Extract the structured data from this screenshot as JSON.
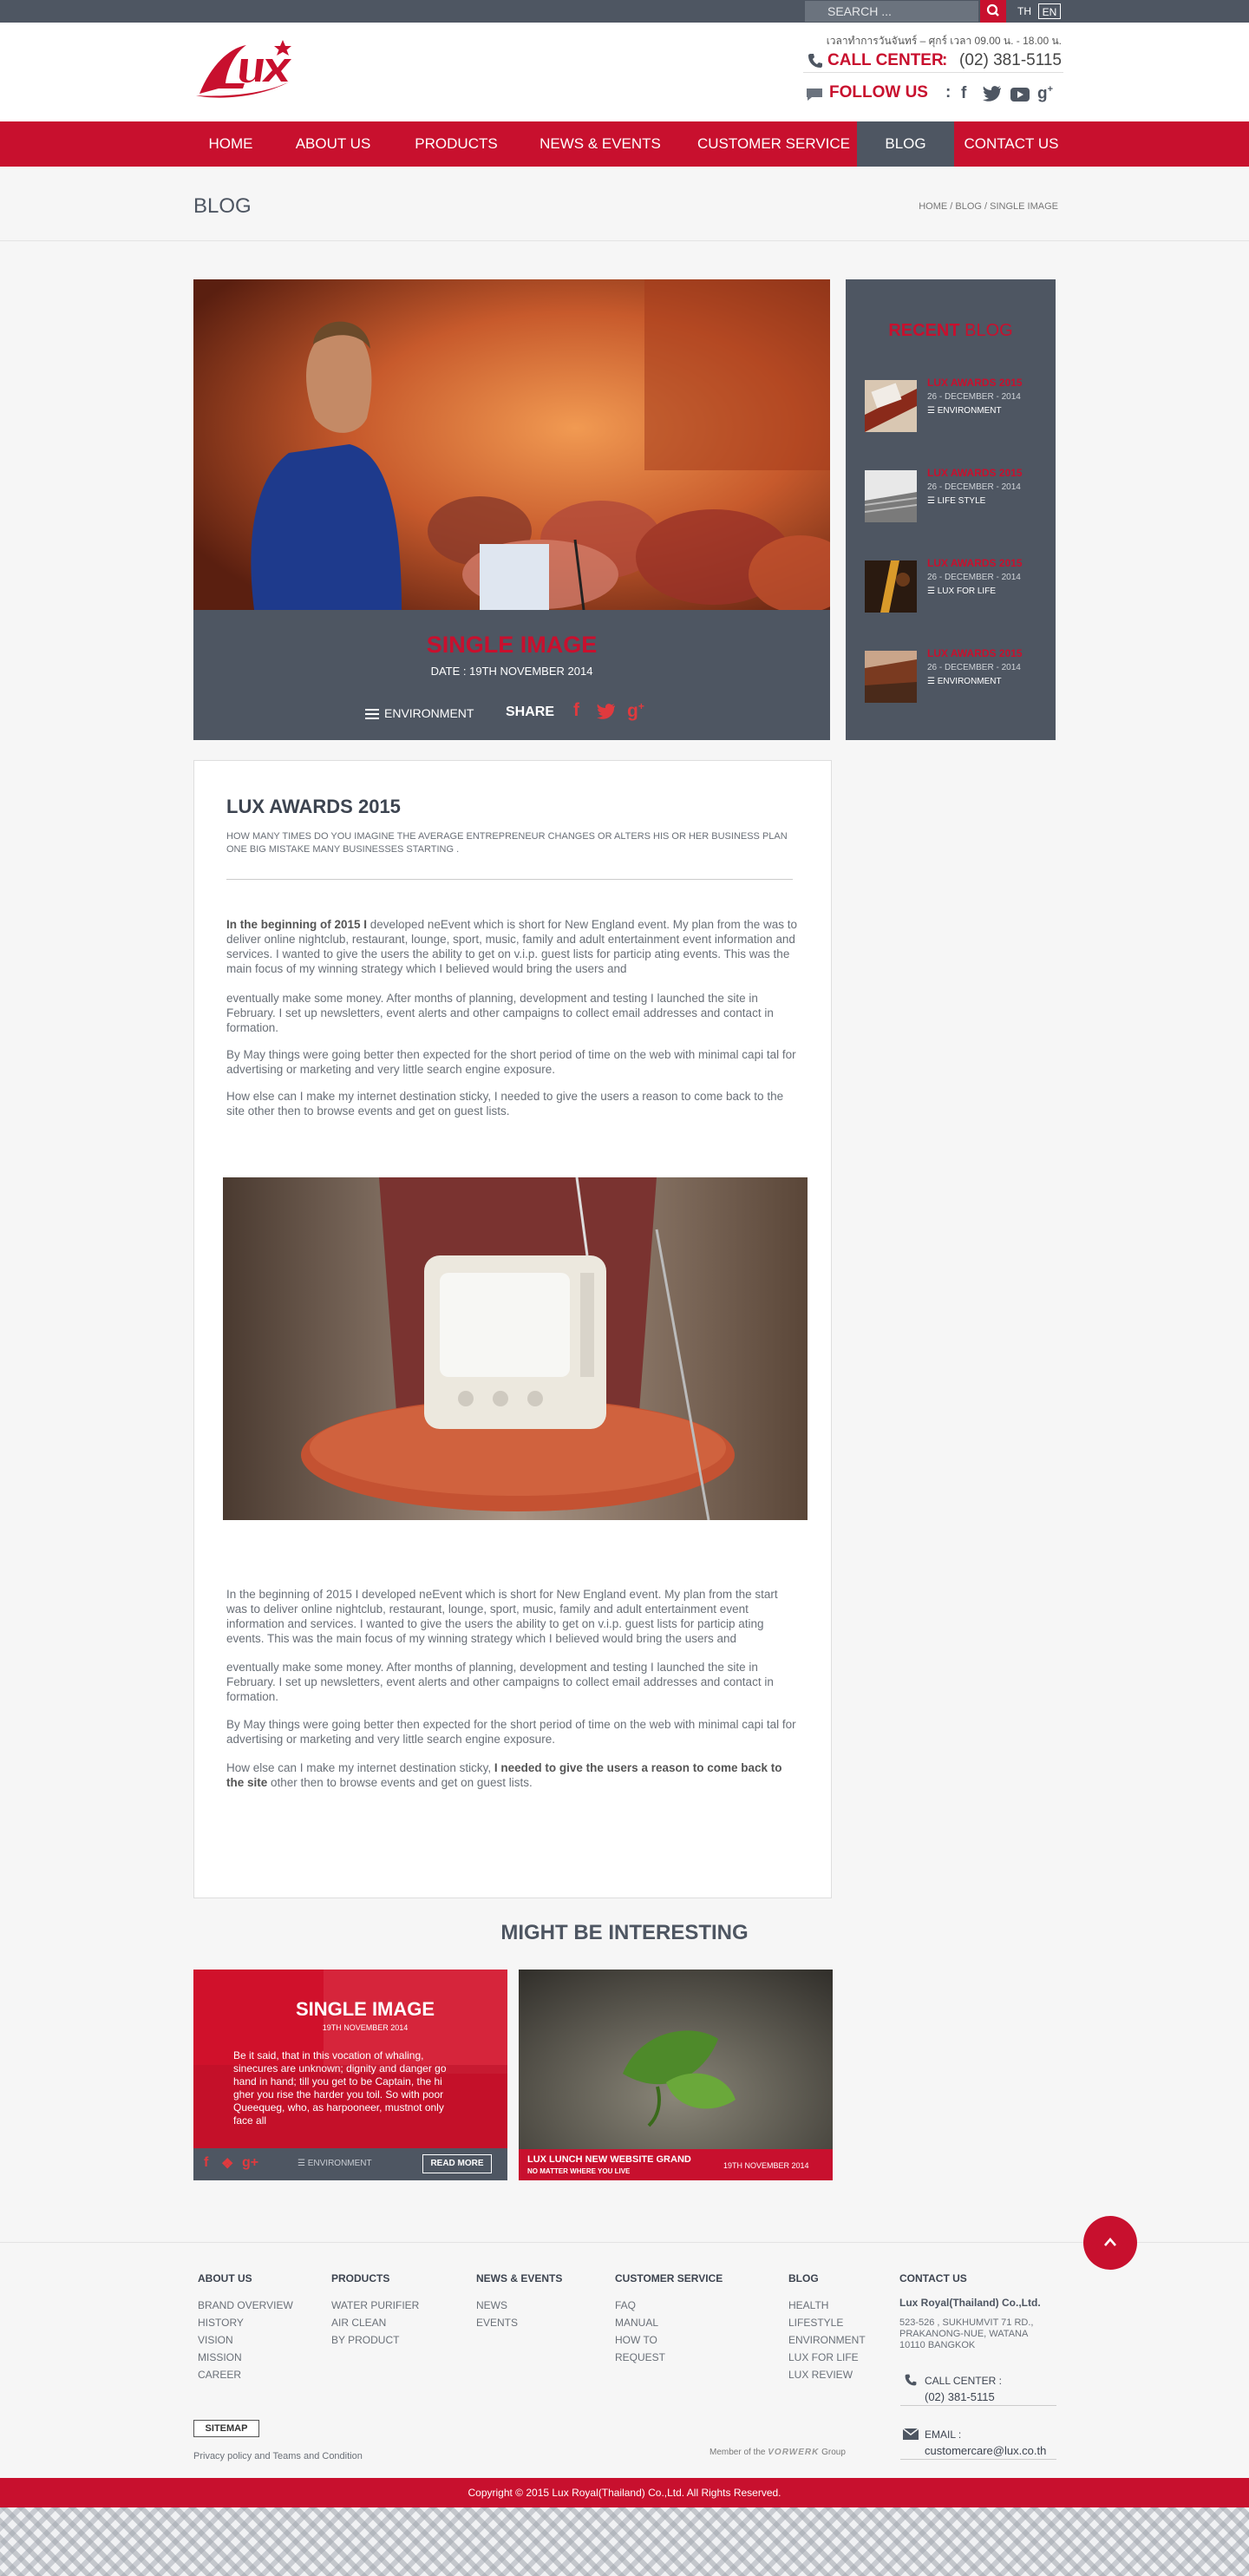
{
  "topbar": {
    "search_placeholder": "SEARCH ...",
    "lang_th": "TH",
    "lang_en": "EN"
  },
  "header": {
    "logo_text": "LUX",
    "hours": "เวลาทำการวันจันทร์ – ศุกร์ เวลา 09.00 น. - 18.00 น.",
    "call_label": "CALL CENTER",
    "call_sep": ":",
    "call_number": "(02) 381-5115",
    "follow_label": "FOLLOW US",
    "follow_sep": ":",
    "social_icons": [
      "facebook-icon",
      "twitter-icon",
      "youtube-icon",
      "google-plus-icon"
    ]
  },
  "nav": {
    "items": [
      "HOME",
      "ABOUT US",
      "PRODUCTS",
      "NEWS & EVENTS",
      "CUSTOMER SERVICE",
      "BLOG",
      "CONTACT US"
    ],
    "active": "BLOG"
  },
  "page": {
    "title": "BLOG",
    "breadcrumb": "HOME /  BLOG / SINGLE IMAGE"
  },
  "hero": {
    "title": "SINGLE IMAGE",
    "date": "DATE : 19TH NOVEMBER 2014",
    "category": "ENVIRONMENT",
    "share_label": "SHARE"
  },
  "sidebar": {
    "title_a": "RECENT",
    "title_b": "BLOG",
    "items": [
      {
        "title": "LUX AWARDS 2015",
        "date": "26 - DECEMBER - 2014",
        "category": "ENVIRONMENT"
      },
      {
        "title": "LUX AWARDS 2015",
        "date": "26 - DECEMBER - 2014",
        "category": "LIFE STYLE"
      },
      {
        "title": "LUX AWARDS 2015",
        "date": "26 - DECEMBER - 2014",
        "category": "LUX FOR LIFE"
      },
      {
        "title": "LUX AWARDS 2015",
        "date": "26 - DECEMBER - 2014",
        "category": "ENVIRONMENT"
      }
    ]
  },
  "article": {
    "title": "LUX AWARDS 2015",
    "lede": "HOW MANY TIMES DO YOU IMAGINE THE AVERAGE ENTREPRENEUR CHANGES OR ALTERS HIS OR HER BUSINESS PLAN ONE BIG MISTAKE MANY BUSINESSES STARTING .",
    "p1_bold": "In the beginning of 2015 I",
    "p1_rest": " developed neEvent which is short for New England event. My plan from the was to deliver online nightclub, restaurant, lounge, sport, music, family and adult entertainment event information and services. I wanted to give the users the ability to get on v.i.p. guest lists for particip ating events. This was the main focus of my winning strategy which I believed would bring the users and",
    "p2": "eventually make some money. After months of planning, development and testing I launched the site in February. I set up newsletters, event alerts and other campaigns to collect email addresses and contact in formation.",
    "p3": "By May things were going better then expected for the short period of time on the web with minimal capi tal for advertising or marketing and very little search engine exposure.",
    "p4": "How else can I make my internet destination sticky, I needed to give the users a reason to come back to the site other then to browse events and get on guest lists.",
    "p5": "In the beginning of 2015 I developed neEvent which is short for New England event. My plan from the start was to deliver online nightclub, restaurant, lounge, sport, music, family and adult entertainment event information and services. I wanted to give the users the ability to get on v.i.p. guest lists for particip ating events. This was the main focus of my winning strategy which I believed would bring the users and",
    "p6": "eventually make some money. After months of planning, development and testing I launched the site in February. I set up newsletters, event alerts and other campaigns to collect email addresses and contact in formation.",
    "p7": "By May things were going better then expected for the short period of time on the web with minimal capi tal for advertising or marketing and very little search engine exposure.",
    "p8_plain": "How else can I make my internet destination sticky, ",
    "p8_bold": "I needed to give the users a reason to come back to the site",
    "p8_rest": " other then to browse events and get on guest lists."
  },
  "related": {
    "heading": "MIGHT BE INTERESTING",
    "card1": {
      "title": "SINGLE IMAGE",
      "date": "19TH NOVEMBER 2014",
      "excerpt": "Be it said, that in this vocation of whaling, sinecures are unknown; dignity and danger go hand in hand; till you get to be Captain, the hi gher you rise the harder you toil. So with poor Queequeg, who, as harpooneer, mustnot only face all",
      "category": "ENVIRONMENT",
      "button": "READ MORE"
    },
    "card2": {
      "title": "LUX LUNCH NEW WEBSITE GRAND",
      "subtitle": "NO MATTER WHERE YOU LIVE",
      "date": "19TH NOVEMBER 2014"
    }
  },
  "footer": {
    "columns": [
      {
        "head": "ABOUT US",
        "links": [
          "BRAND OVERVIEW",
          "HISTORY",
          "VISION",
          "MISSION",
          "CAREER"
        ]
      },
      {
        "head": "PRODUCTS",
        "links": [
          "WATER PURIFIER",
          "AIR CLEAN",
          "BY PRODUCT"
        ]
      },
      {
        "head": "NEWS & EVENTS",
        "links": [
          "NEWS",
          "EVENTS"
        ]
      },
      {
        "head": "CUSTOMER  SERVICE",
        "links": [
          "FAQ",
          "MANUAL",
          "HOW TO",
          "REQUEST"
        ]
      },
      {
        "head": "BLOG",
        "links": [
          "HEALTH",
          "LIFESTYLE",
          "ENVIRONMENT",
          "LUX FOR LIFE",
          "LUX REVIEW"
        ]
      }
    ],
    "contact": {
      "head": "CONTACT US",
      "company": "Lux Royal(Thailand) Co.,Ltd.",
      "address": "523-526 , SUKHUMVIT 71 RD., PRAKANONG-NUE, WATANA 10110 BANGKOK",
      "call_label": "CALL CENTER :",
      "call_value": "(02) 381-5115",
      "email_label": "EMAIL :",
      "email_value": "customercare@lux.co.th"
    },
    "sitemap": "SITEMAP",
    "privacy": "Privacy policy and Teams and Condition",
    "member_pre": "Member of the",
    "member_brand": "VORWERK",
    "member_post": "Group",
    "copyright": "Copyright  © 2015  Lux Royal(Thailand) Co.,Ltd. All Rights Reserved."
  },
  "colors": {
    "brand_red": "#c8102e",
    "slate": "#4e5662",
    "background": "#f6f6f6"
  }
}
